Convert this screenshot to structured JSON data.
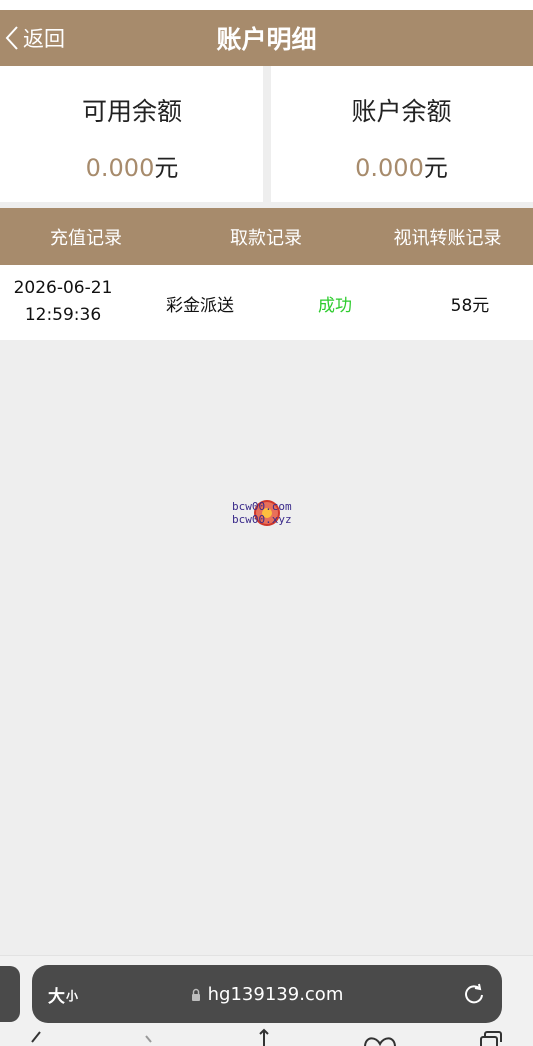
{
  "header": {
    "back_label": "返回",
    "title": "账户明细"
  },
  "balances": {
    "available": {
      "label": "可用余额",
      "amount": "0.000",
      "unit": "元"
    },
    "account": {
      "label": "账户余额",
      "amount": "0.000",
      "unit": "元"
    }
  },
  "tabs": [
    {
      "label": "充值记录"
    },
    {
      "label": "取款记录"
    },
    {
      "label": "视讯转账记录"
    }
  ],
  "records": [
    {
      "date": "2026-06-21",
      "time": "12:59:36",
      "type": "彩金派送",
      "status": "成功",
      "amount": "58元"
    }
  ],
  "watermark": {
    "line1": "bcw00.com",
    "line2": "bcw00.xyz"
  },
  "browser": {
    "text_size_label": "大",
    "text_size_small": "小",
    "url": "hg139139.com"
  },
  "colors": {
    "brand": "#a78b6c",
    "success": "#2ecc2e",
    "background": "#eeeeee"
  }
}
